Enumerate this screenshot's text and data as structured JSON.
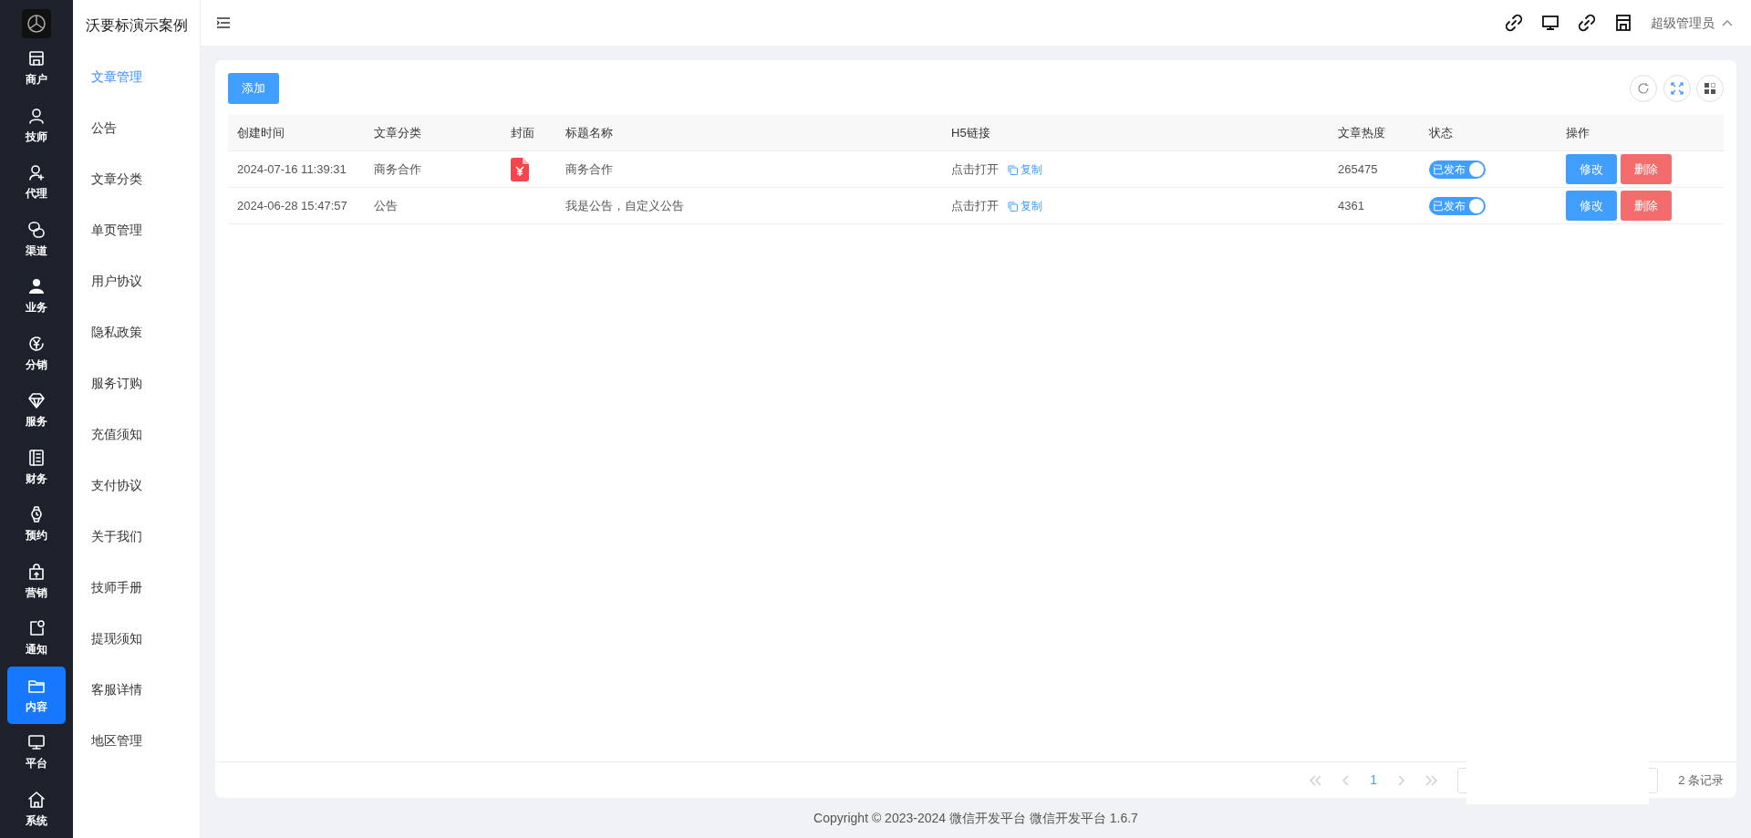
{
  "rail": {
    "items": [
      {
        "label": "商户",
        "selected": false
      },
      {
        "label": "技师",
        "selected": false
      },
      {
        "label": "代理",
        "selected": false
      },
      {
        "label": "渠道",
        "selected": false
      },
      {
        "label": "业务",
        "selected": false
      },
      {
        "label": "分销",
        "selected": false
      },
      {
        "label": "服务",
        "selected": false
      },
      {
        "label": "财务",
        "selected": false
      },
      {
        "label": "预约",
        "selected": false
      },
      {
        "label": "营销",
        "selected": false
      },
      {
        "label": "通知",
        "selected": false
      },
      {
        "label": "内容",
        "selected": true
      },
      {
        "label": "平台",
        "selected": false
      },
      {
        "label": "系统",
        "selected": false
      }
    ]
  },
  "submenu": {
    "title": "沃要标演示案例",
    "items": [
      {
        "label": "文章管理",
        "selected": true
      },
      {
        "label": "公告",
        "selected": false
      },
      {
        "label": "文章分类",
        "selected": false
      },
      {
        "label": "单页管理",
        "selected": false
      },
      {
        "label": "用户协议",
        "selected": false
      },
      {
        "label": "隐私政策",
        "selected": false
      },
      {
        "label": "服务订购",
        "selected": false
      },
      {
        "label": "充值须知",
        "selected": false
      },
      {
        "label": "支付协议",
        "selected": false
      },
      {
        "label": "关于我们",
        "selected": false
      },
      {
        "label": "技师手册",
        "selected": false
      },
      {
        "label": "提现须知",
        "selected": false
      },
      {
        "label": "客服详情",
        "selected": false
      },
      {
        "label": "地区管理",
        "selected": false
      }
    ]
  },
  "header": {
    "user": "超级管理员"
  },
  "toolbar": {
    "add_button": "添加"
  },
  "table": {
    "columns": [
      "创建时间",
      "文章分类",
      "封面",
      "标题名称",
      "H5链接",
      "文章热度",
      "状态",
      "操作"
    ],
    "rows": [
      {
        "created": "2024-07-16 11:39:31",
        "category": "商务合作",
        "has_cover": true,
        "title": "商务合作",
        "link": "点击打开",
        "copy": "复制",
        "heat": "265475",
        "status": {
          "label": "已发布",
          "on": true
        },
        "edit": "修改",
        "delete": "删除"
      },
      {
        "created": "2024-06-28 15:47:57",
        "category": "公告",
        "has_cover": false,
        "title": "我是公告，自定义公告",
        "link": "点击打开",
        "copy": "复制",
        "heat": "4361",
        "status": {
          "label": "已发布",
          "on": true
        },
        "edit": "修改",
        "delete": "删除"
      }
    ]
  },
  "pagination": {
    "pages": [
      {
        "label": "1",
        "selected": true
      }
    ],
    "total": "2 条记录"
  },
  "footer": "Copyright © 2023-2024 微信开发平台  微信开发平台 1.6.7"
}
